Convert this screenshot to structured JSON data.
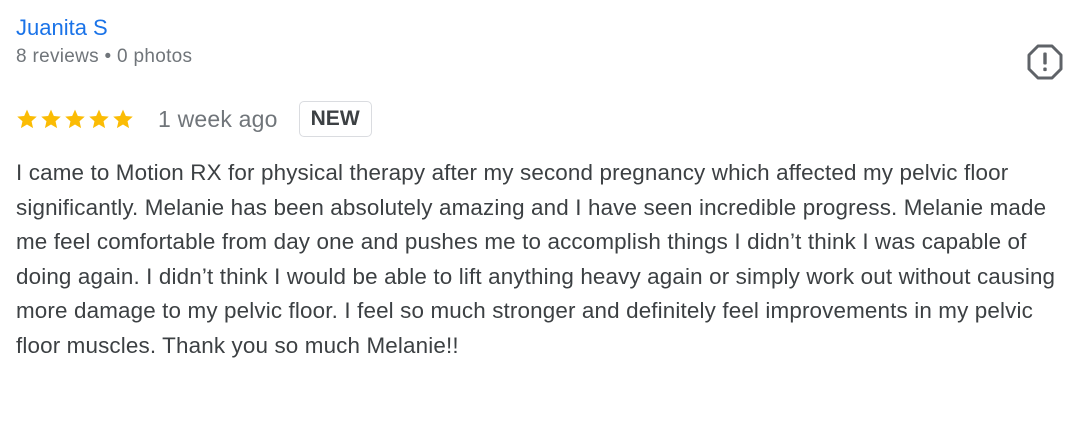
{
  "reviewer": {
    "name": "Juanita S",
    "meta": "8 reviews • 0 photos"
  },
  "rating": {
    "stars": 5,
    "max": 5,
    "star_color": "#fbbc04"
  },
  "review": {
    "date": "1 week ago",
    "badge": "NEW",
    "text": "I came to Motion RX for physical therapy after my second pregnancy which affected my pelvic floor significantly. Melanie has been absolutely amazing and I have seen incredible progress. Melanie made me feel comfortable from day one and pushes me to accomplish things I didn’t think I was capable of doing again. I didn’t think I would be able to lift anything heavy again or simply work out without causing more damage to my pelvic floor. I feel so much stronger and definitely feel improvements in my pelvic floor muscles. Thank you so much Melanie!!"
  },
  "icons": {
    "report": "report-icon",
    "star": "star-icon"
  },
  "colors": {
    "name_link": "#1a73e8",
    "meta_text": "#70757a",
    "body_text": "#3c4043"
  }
}
